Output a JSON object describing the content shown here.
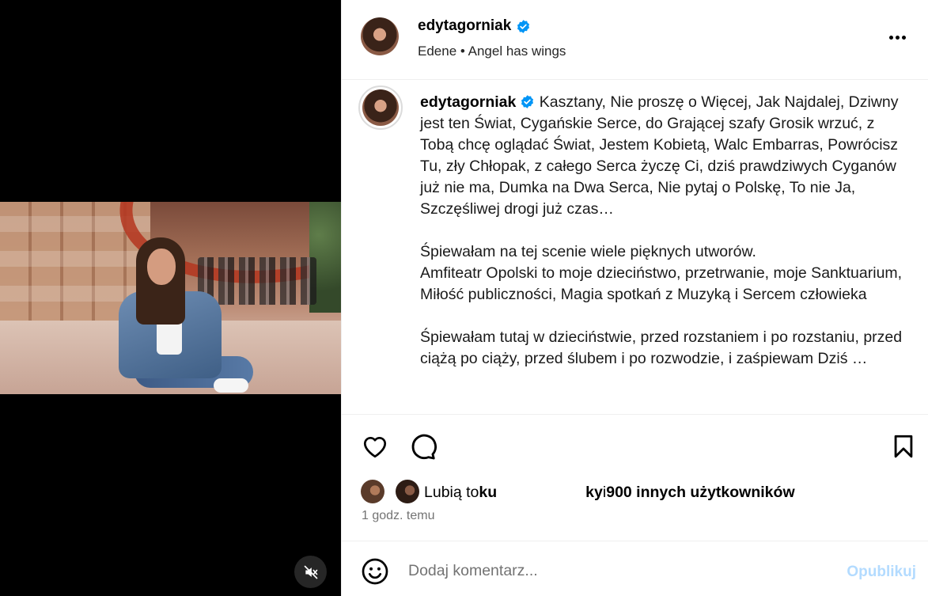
{
  "post": {
    "username": "edytagorniak",
    "location_line": "Edene • Angel has wings",
    "caption_username": "edytagorniak",
    "caption_body": " Kasztany, Nie proszę o Więcej, Jak Najdalej, Dziwny jest ten Świat, Cygańskie Serce, do Grającej szafy Grosik wrzuć, z Tobą chcę oglądać Świat, Jestem Kobietą, Walc Embarras, Powrócisz Tu, zły Chłopak, z całego Serca życzę Ci, dziś prawdziwych Cyganów już nie ma, Dumka na Dwa Serca, Nie pytaj o Polskę, To nie Ja, Szczęśliwej drogi już czas…\n\nŚpiewałam na tej scenie wiele pięknych utworów.\nAmfiteatr Opolski to moje dzieciństwo, przetrwanie, moje Sanktuarium, Miłość publiczności, Magia spotkań z Muzyką i Sercem człowieka\n\nŚpiewałam tutaj w dzieciństwie, przed rozstaniem i po rozstaniu, przed ciążą po ciąży, przed ślubem i po rozwodzie, i zaśpiewam Dziś …",
    "likes_prefix": "Lubią to ",
    "likes_name_start": "ku",
    "likes_name_end": "ky",
    "likes_middle": " i ",
    "likes_others": "900 innych użytkowników",
    "time_ago": "1 godz. temu"
  },
  "comment": {
    "placeholder": "Dodaj komentarz...",
    "publish_label": "Opublikuj"
  },
  "colors": {
    "verified": "#0095f6",
    "publish_disabled": "#b3dbff",
    "muted_text": "#737373"
  },
  "icons": {
    "more": "more-options-icon",
    "like": "heart-icon",
    "comment": "comment-icon",
    "save": "bookmark-icon",
    "emoji": "emoji-icon",
    "mute": "muted-speaker-icon"
  }
}
